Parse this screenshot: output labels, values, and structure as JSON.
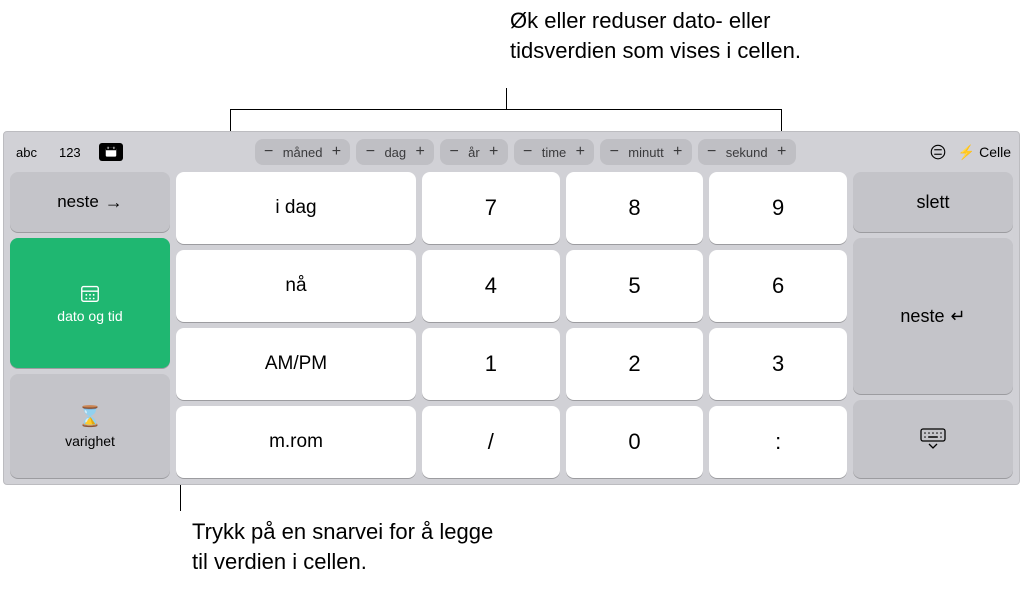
{
  "callouts": {
    "top": "Øk eller reduser dato- eller tidsverdien som vises i cellen.",
    "bottom": "Trykk på en snarvei for å legge til verdien i cellen."
  },
  "topbar": {
    "mode_abc": "abc",
    "mode_123": "123",
    "units": {
      "month": "måned",
      "day": "dag",
      "year": "år",
      "hour": "time",
      "minute": "minutt",
      "second": "sekund"
    },
    "cell_label": "Celle"
  },
  "left": {
    "next": "neste",
    "date_time": "dato og tid",
    "duration": "varighet"
  },
  "shortcuts": {
    "today": "i dag",
    "now": "nå",
    "ampm": "AM/PM",
    "space": "m.rom"
  },
  "numpad": {
    "k7": "7",
    "k8": "8",
    "k9": "9",
    "k4": "4",
    "k5": "5",
    "k6": "6",
    "k1": "1",
    "k2": "2",
    "k3": "3",
    "slash": "/",
    "k0": "0",
    "colon": ":"
  },
  "right": {
    "delete": "slett",
    "next": "neste"
  }
}
